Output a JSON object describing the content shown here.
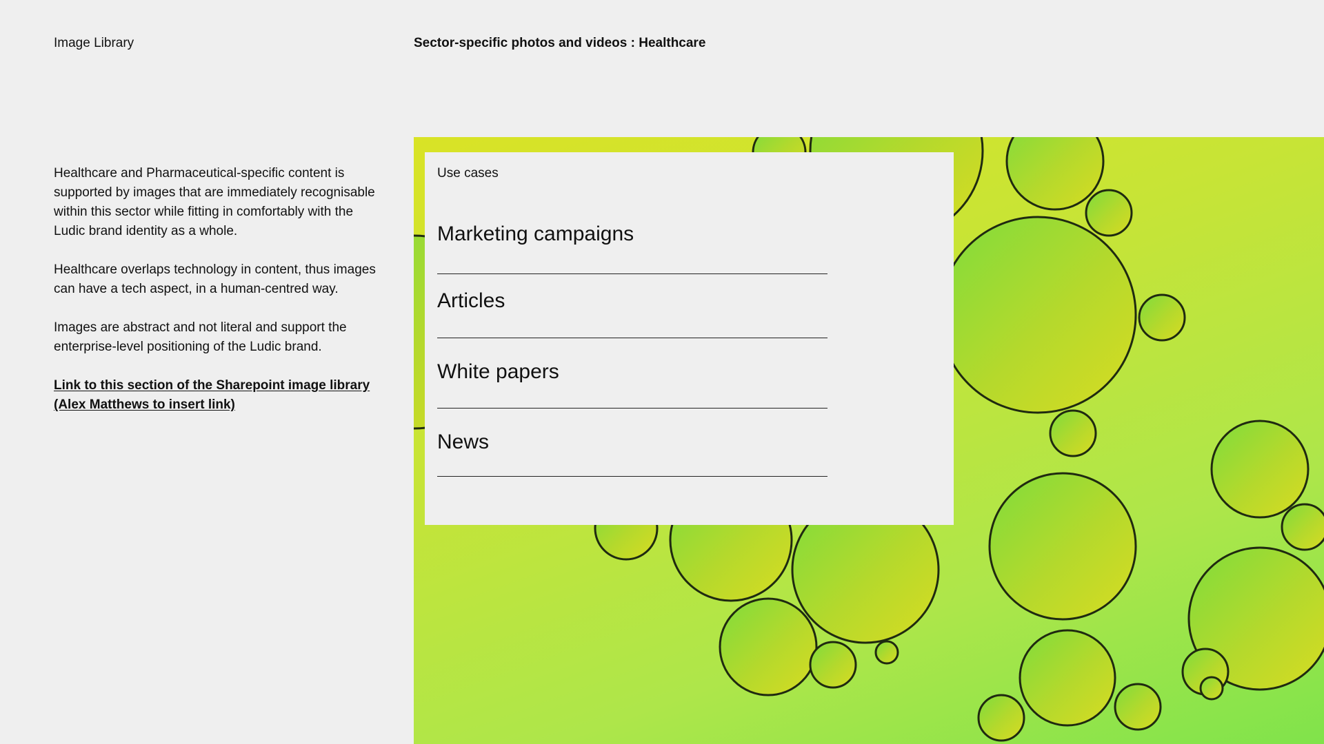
{
  "header": {
    "section": "Image Library",
    "title": "Sector-specific photos and videos : Healthcare"
  },
  "intro": {
    "paragraphs": [
      "Healthcare and Pharmaceutical-specific content is supported by images that are immediately recognisable within this sector while fitting in comfortably with the Ludic brand identity as a whole.",
      "Healthcare overlaps technology in content, thus images can have a tech aspect, in a human-centred way.",
      "Images are abstract and not literal and support the enterprise-level positioning of the Ludic brand."
    ],
    "link_line1": "Link to this section of the Sharepoint image library",
    "link_line2": "(Alex Matthews to insert link)"
  },
  "use_cases": {
    "label": "Use cases",
    "items": [
      "Marketing campaigns",
      "Articles",
      "White papers",
      "News"
    ]
  },
  "colors": {
    "background": "#efefef",
    "hero_gradient_start": "#d9e326",
    "hero_gradient_end": "#80e34b"
  }
}
